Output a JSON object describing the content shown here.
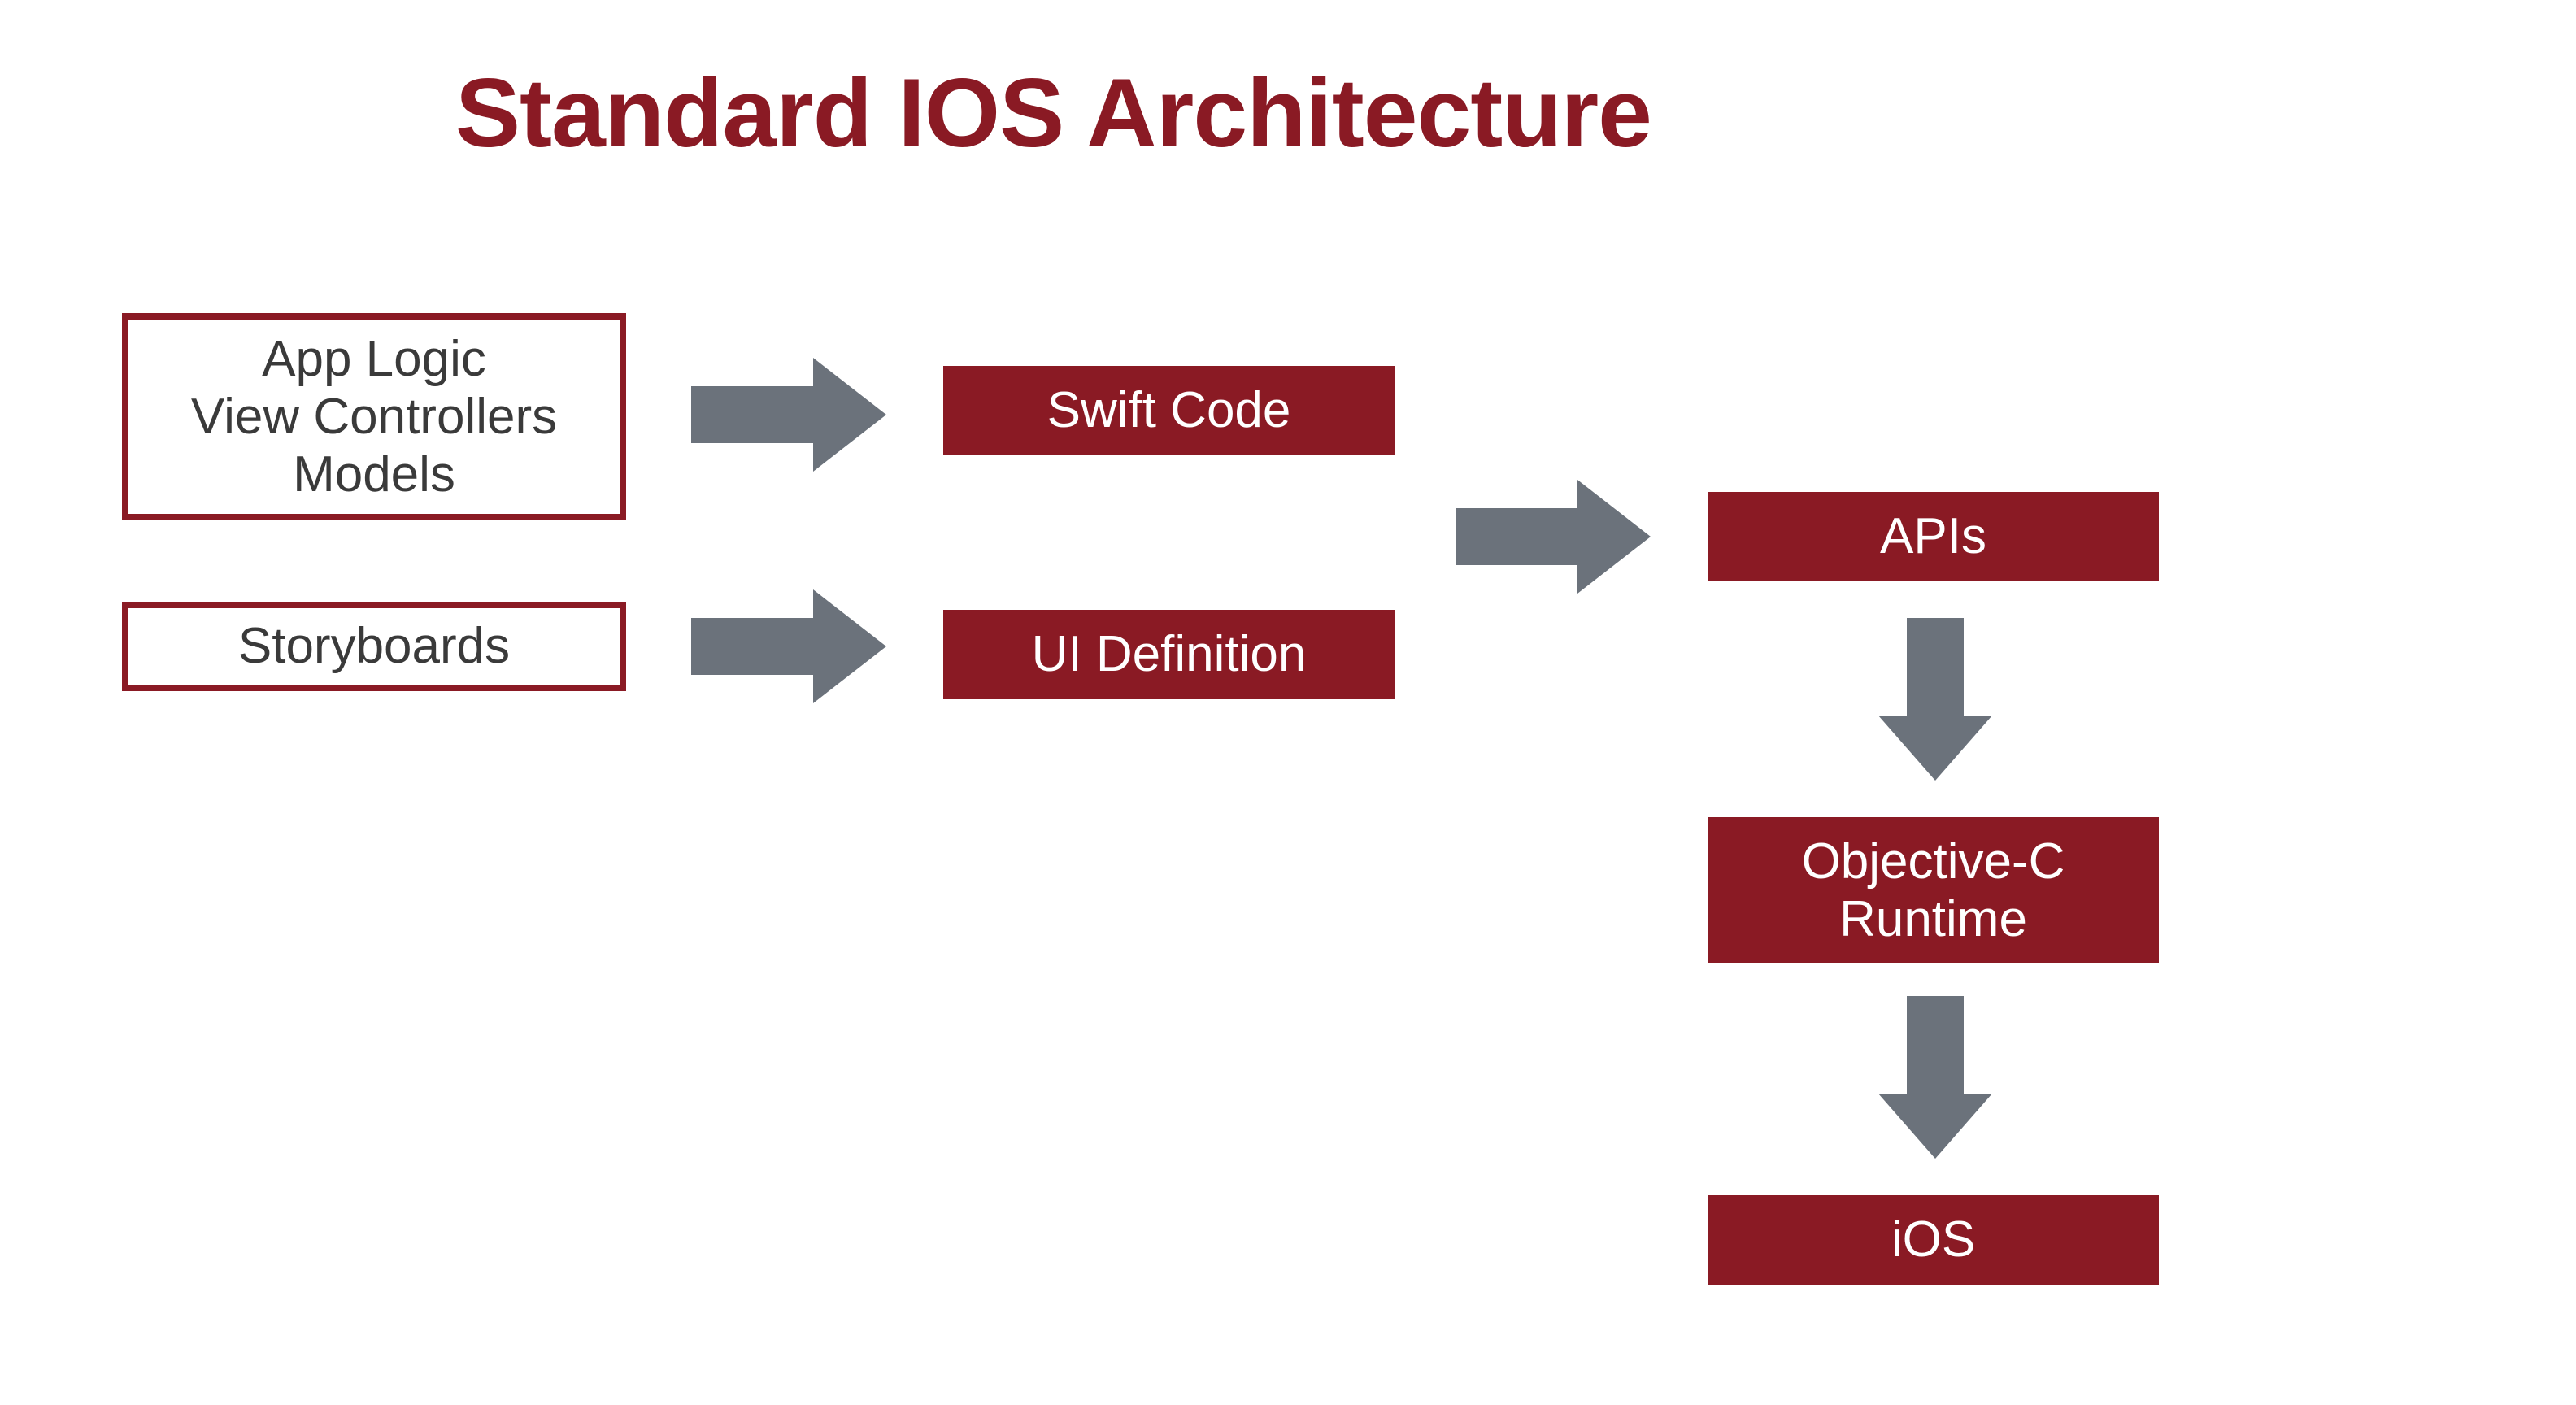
{
  "title": "Standard IOS Architecture",
  "colors": {
    "maroon": "#8a1a24",
    "gray": "#6b727b",
    "text_dark": "#3a3a3a",
    "white": "#ffffff"
  },
  "boxes": {
    "app_logic": {
      "line1": "App Logic",
      "line2": "View Controllers",
      "line3": "Models"
    },
    "storyboards": "Storyboards",
    "swift_code": "Swift Code",
    "ui_definition": "UI Definition",
    "apis": "APIs",
    "objc_runtime_line1": "Objective-C",
    "objc_runtime_line2": "Runtime",
    "ios": "iOS"
  }
}
